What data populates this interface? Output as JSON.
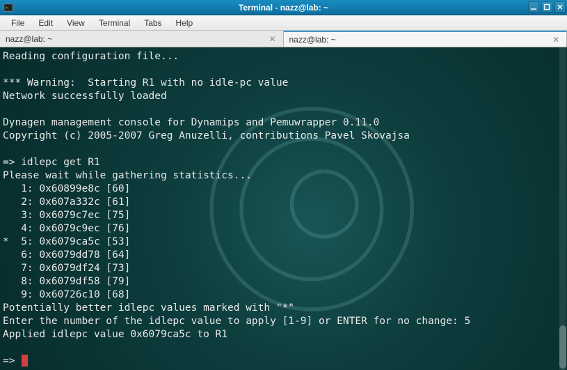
{
  "window": {
    "title": "Terminal - nazz@lab: ~"
  },
  "menubar": {
    "file": "File",
    "edit": "Edit",
    "view": "View",
    "terminal": "Terminal",
    "tabs": "Tabs",
    "help": "Help"
  },
  "tabs": [
    {
      "label": "nazz@lab: ~"
    },
    {
      "label": "nazz@lab: ~"
    }
  ],
  "terminal": {
    "lines": [
      "Reading configuration file...",
      "",
      "*** Warning:  Starting R1 with no idle-pc value",
      "Network successfully loaded",
      "",
      "Dynagen management console for Dynamips and Pemuwrapper 0.11.0",
      "Copyright (c) 2005-2007 Greg Anuzelli, contributions Pavel Skovajsa",
      "",
      "=> idlepc get R1",
      "Please wait while gathering statistics...",
      "   1: 0x60899e8c [60]",
      "   2: 0x607a332c [61]",
      "   3: 0x6079c7ec [75]",
      "   4: 0x6079c9ec [76]",
      "*  5: 0x6079ca5c [53]",
      "   6: 0x6079dd78 [64]",
      "   7: 0x6079df24 [73]",
      "   8: 0x6079df58 [79]",
      "   9: 0x60726c10 [68]",
      "Potentially better idlepc values marked with \"*\"",
      "Enter the number of the idlepc value to apply [1-9] or ENTER for no change: 5",
      "Applied idlepc value 0x6079ca5c to R1",
      "",
      "=> "
    ]
  }
}
